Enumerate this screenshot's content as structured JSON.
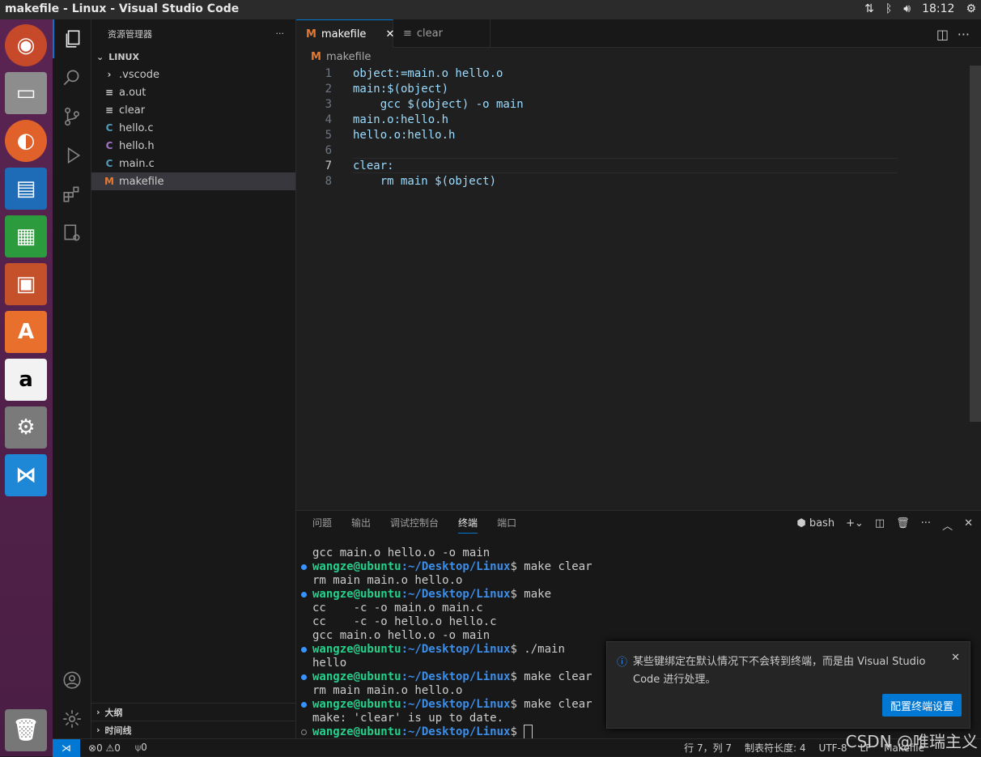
{
  "topbar": {
    "title": "makefile - Linux - Visual Studio Code",
    "time": "18:12"
  },
  "sidebar": {
    "header": "资源管理器",
    "more": "···",
    "root": "LINUX",
    "files": [
      {
        "icon": "›",
        "name": ".vscode",
        "type": "folder"
      },
      {
        "icon": "≡",
        "name": "a.out",
        "type": "file"
      },
      {
        "icon": "≡",
        "name": "clear",
        "type": "file"
      },
      {
        "icon": "C",
        "name": "hello.c",
        "type": "c"
      },
      {
        "icon": "C",
        "name": "hello.h",
        "type": "h"
      },
      {
        "icon": "C",
        "name": "main.c",
        "type": "c"
      },
      {
        "icon": "M",
        "name": "makefile",
        "type": "make"
      }
    ],
    "outline": "大纲",
    "timeline": "时间线"
  },
  "tabs": [
    {
      "label": "makefile",
      "icon": "M"
    },
    {
      "label": "clear",
      "icon": "≡"
    }
  ],
  "breadcrumb": "makefile",
  "code": [
    {
      "n": "1",
      "t": "object:=main.o hello.o"
    },
    {
      "n": "2",
      "t": "main:$(object)"
    },
    {
      "n": "3",
      "t": "    gcc $(object) -o main"
    },
    {
      "n": "4",
      "t": "main.o:hello.h"
    },
    {
      "n": "5",
      "t": "hello.o:hello.h"
    },
    {
      "n": "6",
      "t": ""
    },
    {
      "n": "7",
      "t": "clear:"
    },
    {
      "n": "8",
      "t": "    rm main $(object)"
    }
  ],
  "panel": {
    "tabs": [
      "问题",
      "输出",
      "调试控制台",
      "终端",
      "端口"
    ],
    "active": "终端",
    "shell": "bash"
  },
  "terminal": [
    {
      "dot": "",
      "user": "",
      "path": "",
      "cmd": "gcc main.o hello.o -o main"
    },
    {
      "dot": "blue",
      "user": "wangze@ubuntu",
      "path": ":~/Desktop/Linux",
      "cmd": "$ make clear"
    },
    {
      "dot": "",
      "user": "",
      "path": "",
      "cmd": "rm main main.o hello.o"
    },
    {
      "dot": "blue",
      "user": "wangze@ubuntu",
      "path": ":~/Desktop/Linux",
      "cmd": "$ make"
    },
    {
      "dot": "",
      "user": "",
      "path": "",
      "cmd": "cc    -c -o main.o main.c"
    },
    {
      "dot": "",
      "user": "",
      "path": "",
      "cmd": "cc    -c -o hello.o hello.c"
    },
    {
      "dot": "",
      "user": "",
      "path": "",
      "cmd": "gcc main.o hello.o -o main"
    },
    {
      "dot": "blue",
      "user": "wangze@ubuntu",
      "path": ":~/Desktop/Linux",
      "cmd": "$ ./main"
    },
    {
      "dot": "",
      "user": "",
      "path": "",
      "cmd": "hello"
    },
    {
      "dot": "blue",
      "user": "wangze@ubuntu",
      "path": ":~/Desktop/Linux",
      "cmd": "$ make clear"
    },
    {
      "dot": "",
      "user": "",
      "path": "",
      "cmd": "rm main main.o hello.o"
    },
    {
      "dot": "blue",
      "user": "wangze@ubuntu",
      "path": ":~/Desktop/Linux",
      "cmd": "$ make clear"
    },
    {
      "dot": "",
      "user": "",
      "path": "",
      "cmd": "make: 'clear' is up to date."
    },
    {
      "dot": "hollow",
      "user": "wangze@ubuntu",
      "path": ":~/Desktop/Linux",
      "cmd": "$ "
    }
  ],
  "notification": {
    "line1": "某些键绑定在默认情况下不会转到终端，而是由 Visual Studio",
    "line2": "Code 进行处理。",
    "button": "配置终端设置"
  },
  "status": {
    "errors": "0",
    "warnings": "0",
    "ports": "0",
    "position": "行 7，列 7",
    "tab": "制表符长度: 4",
    "encoding": "UTF-8",
    "eol": "LF",
    "lang": "Makefile"
  },
  "watermark": "CSDN @唯瑞主义"
}
